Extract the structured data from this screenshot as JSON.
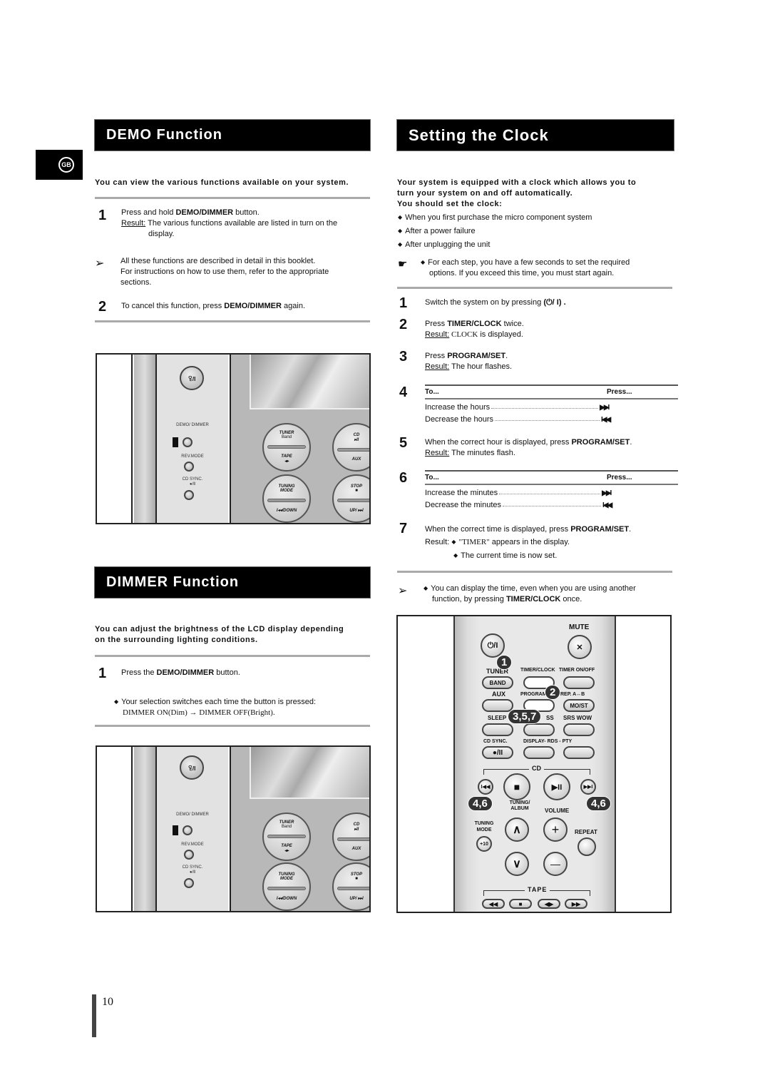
{
  "language_badge": "GB",
  "page_number": "10",
  "demo": {
    "title": "DEMO Function",
    "intro": "You can view the various functions available on your system.",
    "step1_num": "1",
    "step1_pre": "Press and hold ",
    "step1_bold": "DEMO/DIMMER",
    "step1_post": " button.",
    "step1_result_label": "Result:",
    "step1_result": " The various functions available are listed in turn on the",
    "step1_result_2": "display.",
    "note_line1": "All these functions are described in detail in this booklet.",
    "note_line2": "For instructions on how to use them, refer to the appropriate",
    "note_line3": "sections.",
    "step2_num": "2",
    "step2_pre": "To cancel this function, press ",
    "step2_bold": "DEMO/DIMMER",
    "step2_post": " again."
  },
  "dimmer": {
    "title": "DIMMER Function",
    "intro_line1": "You can adjust the brightness of the LCD display depending",
    "intro_line2": "on the surrounding lighting conditions.",
    "step1_num": "1",
    "step1_pre": "Press the ",
    "step1_bold": "DEMO/DIMMER",
    "step1_post": " button.",
    "bullet": "Your selection switches each time the button is pressed:",
    "sequence_on": "DIMMER ON(Dim)",
    "sequence_arrow": "→",
    "sequence_off": "DIMMER OFF(Bright)."
  },
  "front_panel": {
    "power_label": "ꄗ/I",
    "demo_dimmer_label": "DEMO/ DIMMER",
    "rev_mode_label": "REV.MODE",
    "cd_sync_label": "CD SYNC.",
    "cd_sync_sub": "●/Ⅱ",
    "tuner_top": "TUNER",
    "tuner_sub": "Band",
    "tape_label": "TAPE",
    "tape_sub": "◂▸",
    "cd_top": "CD",
    "cd_sub": "▸II",
    "aux_label": "AUX",
    "tuning_mode_top": "TUNING",
    "tuning_mode_2": "MODE",
    "down_label": "I◂◂/DOWN",
    "stop_top": "STOP",
    "stop_sub": "■",
    "up_label": "UP/ ▸▸I"
  },
  "clock": {
    "title": "Setting the Clock",
    "intro_line1": "Your system is equipped with a clock which allows you to",
    "intro_line2": "turn your system on and off automatically.",
    "intro_line3": "You should set the clock:",
    "bullets": [
      "When you first purchase the micro component system",
      "After a power failure",
      "After unplugging the unit"
    ],
    "tip_line1": "For each step, you have a few seconds to set the required",
    "tip_line2": "options. If you exceed this time, you must start again.",
    "steps": {
      "s1_num": "1",
      "s1_text": "Switch the system on by pressing",
      "s1_symbol": "(⏻/ I) .",
      "s2_num": "2",
      "s2_pre": "Press ",
      "s2_bold": "TIMER/CLOCK",
      "s2_post": " twice.",
      "s2_result_label": "Result:",
      "s2_result_serif": " CLOCK",
      "s2_result_post": " is displayed.",
      "s3_num": "3",
      "s3_pre": "Press ",
      "s3_bold": "PROGRAM/SET",
      "s3_post": ".",
      "s3_result_label": "Result:",
      "s3_result": " The hour flashes.",
      "s4_num": "4",
      "s5_num": "5",
      "s5_pre": "When the correct hour is displayed, press ",
      "s5_bold": "PROGRAM/SET",
      "s5_post": ".",
      "s5_result_label": "Result:",
      "s5_result": " The minutes flash.",
      "s6_num": "6",
      "s7_num": "7",
      "s7_pre": "When the correct time is displayed, press ",
      "s7_bold": "PROGRAM/SET",
      "s7_post": ".",
      "s7_result_label": "Result:",
      "s7_result_serif": "\"TIMER\"",
      "s7_result_1": " appears in the display.",
      "s7_result_2": "The current time is now set."
    },
    "table_hours": {
      "col_to": "To...",
      "col_press": "Press...",
      "rows": [
        {
          "label": "Increase the hours",
          "icon": "▶▶I"
        },
        {
          "label": "Decrease the hours",
          "icon": "I◀◀"
        }
      ]
    },
    "table_minutes": {
      "col_to": "To...",
      "col_press": "Press...",
      "rows": [
        {
          "label": "Increase the minutes",
          "icon": "▶▶I"
        },
        {
          "label": "Decrease the minutes",
          "icon": "I◀◀"
        }
      ]
    },
    "note_pre": "You can display the time, even when you are using another",
    "note_line2_pre": "function, by pressing ",
    "note_bold": "TIMER/CLOCK",
    "note_post": " once."
  },
  "remote": {
    "mute": "MUTE",
    "power": "⏻/I",
    "mute_icon": "🔇",
    "tuner": "TUNER",
    "band": "BAND",
    "timer_clock": "TIMER/CLOCK",
    "timer_onoff": "TIMER ON/OFF",
    "aux": "AUX",
    "program": "PROGRAM",
    "rep_ab": "REP. A↔B",
    "mo_st": "MO/ST",
    "sleep": "SLEEP",
    "ss": "SS",
    "srs_wow": "SRS WOW",
    "cd_sync": "CD SYNC.",
    "rec_pause": "●/II",
    "display_rds_pty": "DISPLAY- RDS - PTY",
    "cd": "CD",
    "prev": "I◀◀",
    "stop": "■",
    "play_pause": "▶II",
    "next": "▶▶I",
    "tuning_album": "TUNING/ ALBUM",
    "volume": "VOLUME",
    "tuning_mode": "TUNING MODE",
    "plus10": "+10",
    "up": "∧",
    "vol_up": "+",
    "repeat": "REPEAT",
    "down": "∨",
    "vol_down": "—",
    "tape": "TAPE",
    "rew": "◀◀",
    "tape_stop": "■",
    "tape_play": "◀▶",
    "ff": "▶▶",
    "callouts": {
      "c1": "1",
      "c2": "2",
      "c357": "3,5,7",
      "c46_left": "4,6",
      "c46_right": "4,6"
    }
  }
}
